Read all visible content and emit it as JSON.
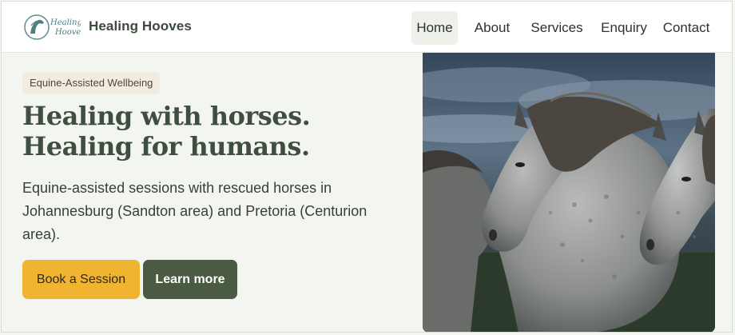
{
  "brand": {
    "logo_text_line1": "Healing",
    "logo_text_line2": "Hooves",
    "name": "Healing Hooves"
  },
  "nav": {
    "items": [
      {
        "label": "Home",
        "active": true
      },
      {
        "label": "About",
        "active": false
      },
      {
        "label": "Services",
        "active": false
      },
      {
        "label": "Enquiry",
        "active": false
      },
      {
        "label": "Contact",
        "active": false
      }
    ]
  },
  "hero": {
    "badge": "Equine-Assisted Wellbeing",
    "headline": "Healing with horses. Healing for humans.",
    "lede": "Equine-assisted sessions with rescued horses in Johannesburg (Sandton area) and Pretoria (Centurion area).",
    "primary_button": "Book a Session",
    "secondary_button": "Learn more",
    "image_subject": "two grey dappled horses with windswept manes under a stormy sky"
  },
  "colors": {
    "accent_yellow": "#f0b430",
    "forest_green": "#4b5a43",
    "headline_green": "#3f4f3f",
    "page_bg": "#f3f5f0"
  }
}
